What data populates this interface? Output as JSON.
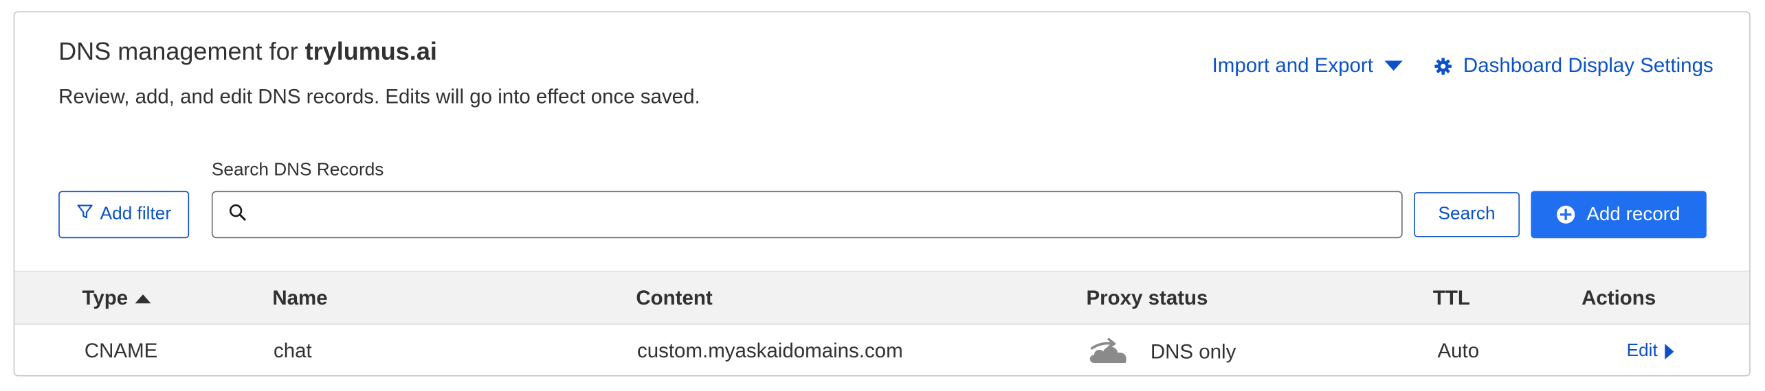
{
  "header": {
    "title_prefix": "DNS management for ",
    "domain": "trylumus.ai",
    "subtitle": "Review, add, and edit DNS records. Edits will go into effect once saved.",
    "import_export_label": "Import and Export",
    "display_settings_label": "Dashboard Display Settings"
  },
  "toolbar": {
    "add_filter_label": "Add filter",
    "search_label": "Search DNS Records",
    "search_value": "",
    "search_placeholder": "",
    "search_button_label": "Search",
    "add_record_label": "Add record"
  },
  "table": {
    "columns": {
      "type": "Type",
      "name": "Name",
      "content": "Content",
      "proxy_status": "Proxy status",
      "ttl": "TTL",
      "actions": "Actions"
    },
    "rows": [
      {
        "type": "CNAME",
        "name": "chat",
        "content": "custom.myaskaidomains.com",
        "proxy_status": "DNS only",
        "ttl": "Auto",
        "action": "Edit"
      }
    ]
  },
  "colors": {
    "link": "#0b52c9",
    "primary_button": "#1f6ff0",
    "table_header_bg": "#f2f2f2",
    "text": "#313131"
  }
}
